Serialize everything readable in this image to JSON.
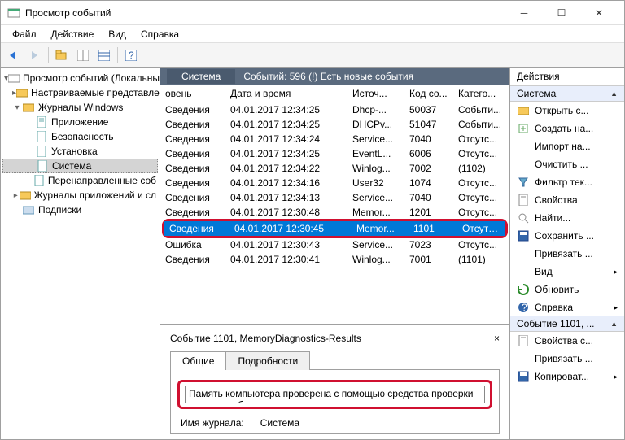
{
  "window": {
    "title": "Просмотр событий"
  },
  "menu": [
    "Файл",
    "Действие",
    "Вид",
    "Справка"
  ],
  "tree": {
    "root": "Просмотр событий (Локальны",
    "custom": "Настраиваемые представле",
    "winlogs": "Журналы Windows",
    "app": "Приложение",
    "sec": "Безопасность",
    "setup": "Установка",
    "sys": "Система",
    "fwd": "Перенаправленные соб",
    "applogs": "Журналы приложений и сл",
    "subs": "Подписки"
  },
  "header": {
    "name": "Система",
    "stats": "Событий: 596 (!) Есть новые события"
  },
  "cols": [
    "овень",
    "Дата и время",
    "Источ...",
    "Код со...",
    "Катего..."
  ],
  "rows": [
    {
      "lvl": "Сведения",
      "dt": "04.01.2017 12:34:25",
      "src": "Dhcp-...",
      "id": "50037",
      "cat": "Событи..."
    },
    {
      "lvl": "Сведения",
      "dt": "04.01.2017 12:34:25",
      "src": "DHCPv...",
      "id": "51047",
      "cat": "Событи..."
    },
    {
      "lvl": "Сведения",
      "dt": "04.01.2017 12:34:24",
      "src": "Service...",
      "id": "7040",
      "cat": "Отсутс..."
    },
    {
      "lvl": "Сведения",
      "dt": "04.01.2017 12:34:25",
      "src": "EventL...",
      "id": "6006",
      "cat": "Отсутс..."
    },
    {
      "lvl": "Сведения",
      "dt": "04.01.2017 12:34:22",
      "src": "Winlog...",
      "id": "7002",
      "cat": "(1102)"
    },
    {
      "lvl": "Сведения",
      "dt": "04.01.2017 12:34:16",
      "src": "User32",
      "id": "1074",
      "cat": "Отсутс..."
    },
    {
      "lvl": "Сведения",
      "dt": "04.01.2017 12:34:13",
      "src": "Service...",
      "id": "7040",
      "cat": "Отсутс..."
    },
    {
      "lvl": "Сведения",
      "dt": "04.01.2017 12:30:48",
      "src": "Memor...",
      "id": "1201",
      "cat": "Отсутс..."
    },
    {
      "lvl": "Сведения",
      "dt": "04.01.2017 12:30:45",
      "src": "Memor...",
      "id": "1101",
      "cat": "Отсутс...",
      "sel": true,
      "hl": true
    },
    {
      "lvl": "Ошибка",
      "dt": "04.01.2017 12:30:43",
      "src": "Service...",
      "id": "7023",
      "cat": "Отсутс..."
    },
    {
      "lvl": "Сведения",
      "dt": "04.01.2017 12:30:41",
      "src": "Winlog...",
      "id": "7001",
      "cat": "(1101)"
    }
  ],
  "detail": {
    "title": "Событие 1101, MemoryDiagnostics-Results",
    "tab_general": "Общие",
    "tab_details": "Подробности",
    "message": "Память компьютера проверена с помощью средства проверки памят не обнаружено",
    "k_log": "Имя журнала:",
    "v_log": "Система"
  },
  "actions": {
    "title": "Действия",
    "group1": "Система",
    "items1": [
      "Открыть с...",
      "Создать на...",
      "Импорт на...",
      "Очистить ...",
      "Фильтр тек...",
      "Свойства",
      "Найти...",
      "Сохранить ...",
      "Привязать ...",
      "Вид",
      "Обновить",
      "Справка"
    ],
    "group2": "Событие 1101, ...",
    "items2": [
      "Свойства с...",
      "Привязать ...",
      "Копироват..."
    ]
  }
}
